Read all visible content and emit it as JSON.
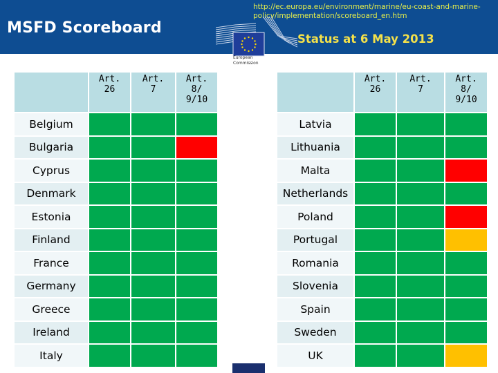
{
  "header": {
    "title": "MSFD Scoreboard",
    "url": "http://ec.europa.eu/environment/marine/eu-coast-and-marine-policy/implementation/scoreboard_en.htm",
    "status": "Status at 6 May 2013",
    "logo_text_line1": "European",
    "logo_text_line2": "Commission"
  },
  "colors": {
    "banner": "#0e4d92",
    "green": "#00a94f",
    "red": "#ff0000",
    "amber": "#ffc000",
    "header_cell": "#b9dde3"
  },
  "columns": [
    "Art.\n26",
    "Art.\n7",
    "Art.\n8/\n9/10"
  ],
  "column_labels": [
    {
      "line1": "Art.",
      "line2": "26",
      "line3": ""
    },
    {
      "line1": "Art.",
      "line2": "7",
      "line3": ""
    },
    {
      "line1": "Art.",
      "line2": "8/",
      "line3": "9/10"
    }
  ],
  "left_table": [
    {
      "country": "Belgium",
      "status": [
        "green",
        "green",
        "green"
      ]
    },
    {
      "country": "Bulgaria",
      "status": [
        "green",
        "green",
        "red"
      ]
    },
    {
      "country": "Cyprus",
      "status": [
        "green",
        "green",
        "green"
      ]
    },
    {
      "country": "Denmark",
      "status": [
        "green",
        "green",
        "green"
      ]
    },
    {
      "country": "Estonia",
      "status": [
        "green",
        "green",
        "green"
      ]
    },
    {
      "country": "Finland",
      "status": [
        "green",
        "green",
        "green"
      ]
    },
    {
      "country": "France",
      "status": [
        "green",
        "green",
        "green"
      ]
    },
    {
      "country": "Germany",
      "status": [
        "green",
        "green",
        "green"
      ]
    },
    {
      "country": "Greece",
      "status": [
        "green",
        "green",
        "green"
      ]
    },
    {
      "country": "Ireland",
      "status": [
        "green",
        "green",
        "green"
      ]
    },
    {
      "country": "Italy",
      "status": [
        "green",
        "green",
        "green"
      ]
    }
  ],
  "right_table": [
    {
      "country": "Latvia",
      "status": [
        "green",
        "green",
        "green"
      ]
    },
    {
      "country": "Lithuania",
      "status": [
        "green",
        "green",
        "green"
      ]
    },
    {
      "country": "Malta",
      "status": [
        "green",
        "green",
        "red"
      ]
    },
    {
      "country": "Netherlands",
      "status": [
        "green",
        "green",
        "green"
      ]
    },
    {
      "country": "Poland",
      "status": [
        "green",
        "green",
        "red"
      ]
    },
    {
      "country": "Portugal",
      "status": [
        "green",
        "green",
        "amber"
      ]
    },
    {
      "country": "Romania",
      "status": [
        "green",
        "green",
        "green"
      ]
    },
    {
      "country": "Slovenia",
      "status": [
        "green",
        "green",
        "green"
      ]
    },
    {
      "country": "Spain",
      "status": [
        "green",
        "green",
        "green"
      ]
    },
    {
      "country": "Sweden",
      "status": [
        "green",
        "green",
        "green"
      ]
    },
    {
      "country": "UK",
      "status": [
        "green",
        "green",
        "amber"
      ]
    }
  ]
}
